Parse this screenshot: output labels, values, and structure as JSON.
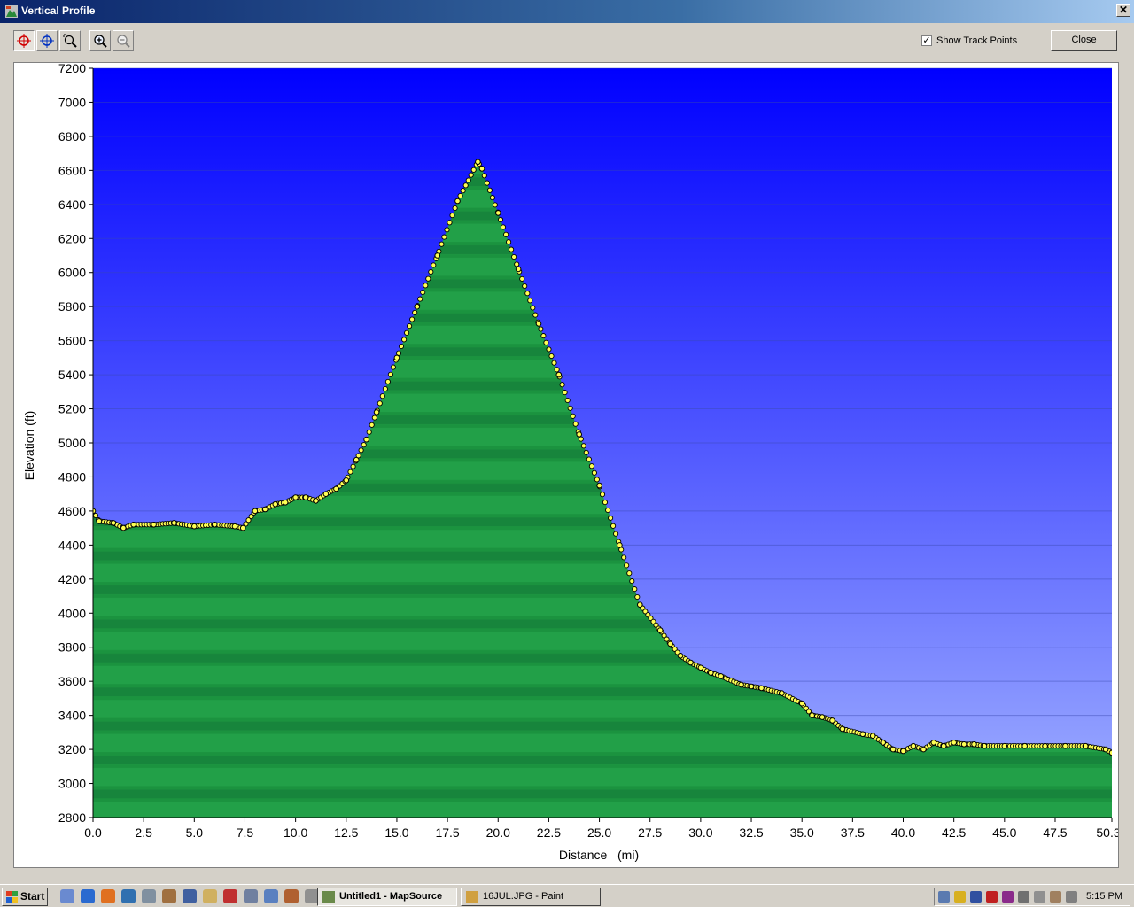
{
  "window": {
    "title": "Vertical Profile",
    "close_glyph": "✕"
  },
  "toolbar": {
    "buttons": [
      "select-tool-icon",
      "center-map-icon",
      "zoom-area-icon",
      "zoom-in-icon",
      "zoom-out-icon"
    ],
    "show_track_points_label": "Show Track Points",
    "show_track_points_checked": true,
    "close_label": "Close"
  },
  "colors": {
    "sky_top": "#0000ff",
    "sky_bottom": "#a0b0ff",
    "terrain": "#1f9e46",
    "terrain_dark": "#13803a",
    "track_point": "#ffff55"
  },
  "chart_data": {
    "type": "area",
    "title": "",
    "xlabel": "Distance   (mi)",
    "ylabel": "Elevation (ft)",
    "xlim": [
      0,
      50.3
    ],
    "ylim": [
      2800,
      7200
    ],
    "x_ticks": [
      "0.0",
      "2.5",
      "5.0",
      "7.5",
      "10.0",
      "12.5",
      "15.0",
      "17.5",
      "20.0",
      "22.5",
      "25.0",
      "27.5",
      "30.0",
      "32.5",
      "35.0",
      "37.5",
      "40.0",
      "42.5",
      "45.0",
      "47.5",
      "50.3"
    ],
    "y_ticks": [
      "2800",
      "3000",
      "3200",
      "3400",
      "3600",
      "3800",
      "4000",
      "4200",
      "4400",
      "4600",
      "4800",
      "5000",
      "5200",
      "5400",
      "5600",
      "5800",
      "6000",
      "6200",
      "6400",
      "6600",
      "6800",
      "7000",
      "7200"
    ],
    "grid": true,
    "x": [
      0,
      0.3,
      1,
      1.5,
      2,
      3,
      4,
      5,
      6,
      7,
      7.4,
      8,
      8.5,
      9,
      9.5,
      10,
      10.5,
      11,
      11.5,
      12,
      12.5,
      13,
      13.5,
      14,
      15,
      16,
      17,
      18,
      19,
      19.2,
      20,
      21,
      22,
      23,
      24,
      25,
      26,
      27,
      28,
      28.5,
      29,
      29.5,
      30,
      30.5,
      31,
      32,
      32.5,
      33,
      34,
      35,
      35.5,
      36,
      36.5,
      37,
      38,
      38.5,
      39,
      39.5,
      40,
      40.5,
      41,
      41.5,
      42,
      42.5,
      43,
      43.5,
      44,
      45,
      46,
      47,
      48,
      49,
      50,
      50.3
    ],
    "y": [
      4600,
      4540,
      4530,
      4500,
      4520,
      4520,
      4530,
      4510,
      4520,
      4510,
      4500,
      4600,
      4610,
      4640,
      4650,
      4680,
      4680,
      4660,
      4700,
      4730,
      4780,
      4900,
      5020,
      5180,
      5500,
      5800,
      6100,
      6420,
      6650,
      6610,
      6350,
      6020,
      5700,
      5400,
      5050,
      4750,
      4400,
      4050,
      3900,
      3820,
      3750,
      3710,
      3680,
      3650,
      3630,
      3580,
      3570,
      3560,
      3530,
      3470,
      3400,
      3390,
      3370,
      3320,
      3290,
      3280,
      3240,
      3200,
      3190,
      3220,
      3200,
      3240,
      3220,
      3240,
      3230,
      3230,
      3220,
      3220,
      3220,
      3220,
      3220,
      3220,
      3200,
      3180
    ]
  },
  "taskbar": {
    "start_label": "Start",
    "quick_launch": [
      "desktop-icon",
      "ie-icon",
      "firefox-icon",
      "network-icon",
      "mail-icon",
      "gps-icon",
      "book-icon",
      "folder-icon",
      "pdf-icon",
      "calculator-icon",
      "document-icon",
      "image-icon",
      "notepad-icon"
    ],
    "tasks": [
      {
        "label": "Untitled1 - MapSource",
        "active": true
      },
      {
        "label": "16JUL.JPG - Paint",
        "active": false
      }
    ],
    "clock": "5:15 PM"
  }
}
